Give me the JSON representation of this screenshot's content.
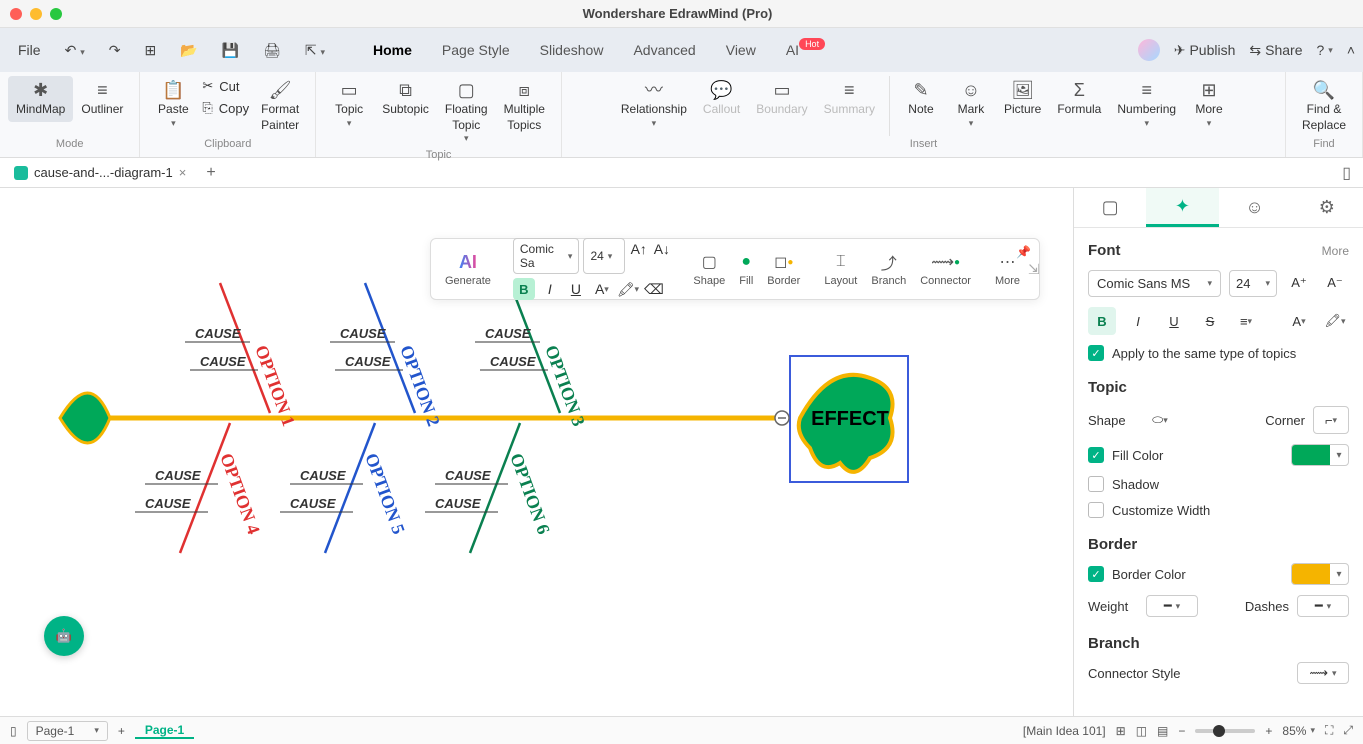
{
  "titlebar": {
    "title": "Wondershare EdrawMind (Pro)"
  },
  "qat": {
    "file": "File",
    "tabs": [
      "Home",
      "Page Style",
      "Slideshow",
      "Advanced",
      "View",
      "AI"
    ],
    "ai_badge": "Hot",
    "publish": "Publish",
    "share": "Share"
  },
  "ribbon": {
    "mode": {
      "label": "Mode",
      "mindmap": "MindMap",
      "outliner": "Outliner"
    },
    "clipboard": {
      "label": "Clipboard",
      "paste": "Paste",
      "cut": "Cut",
      "copy": "Copy",
      "format_painter": "Format\nPainter"
    },
    "topic": {
      "label": "Topic",
      "topic": "Topic",
      "subtopic": "Subtopic",
      "floating": "Floating\nTopic",
      "multiple": "Multiple\nTopics"
    },
    "insert": {
      "label": "Insert",
      "relationship": "Relationship",
      "callout": "Callout",
      "boundary": "Boundary",
      "summary": "Summary",
      "note": "Note",
      "mark": "Mark",
      "picture": "Picture",
      "formula": "Formula",
      "numbering": "Numbering",
      "more": "More"
    },
    "find": {
      "label": "Find",
      "find_replace": "Find &\nReplace"
    }
  },
  "doctab": {
    "name": "cause-and-...-diagram-1"
  },
  "float_toolbar": {
    "ai": "AI",
    "ai_sub": "Generate",
    "font": "Comic Sa",
    "size": "24",
    "shape": "Shape",
    "fill": "Fill",
    "border": "Border",
    "layout": "Layout",
    "branch": "Branch",
    "connector": "Connector",
    "more": "More"
  },
  "canvas": {
    "effect": "EFFECT",
    "options": [
      "OPTION 1",
      "OPTION 2",
      "OPTION 3",
      "OPTION 4",
      "OPTION 5",
      "OPTION 6"
    ],
    "cause": "CAUSE"
  },
  "sidepanel": {
    "font": {
      "title": "Font",
      "more": "More",
      "family": "Comic Sans MS",
      "size": "24",
      "apply_same": "Apply to the same type of topics"
    },
    "topic_s": {
      "title": "Topic",
      "shape": "Shape",
      "corner": "Corner",
      "fill": "Fill Color",
      "shadow": "Shadow",
      "custom_w": "Customize Width",
      "fill_color": "#00a859"
    },
    "border_s": {
      "title": "Border",
      "border_color_lbl": "Border Color",
      "border_color": "#f5b400",
      "weight": "Weight",
      "dashes": "Dashes"
    },
    "branch_s": {
      "title": "Branch",
      "connector": "Connector Style"
    }
  },
  "statusbar": {
    "page_sel": "Page-1",
    "page_active": "Page-1",
    "main_idea": "[Main Idea 101]",
    "zoom": "85%"
  }
}
